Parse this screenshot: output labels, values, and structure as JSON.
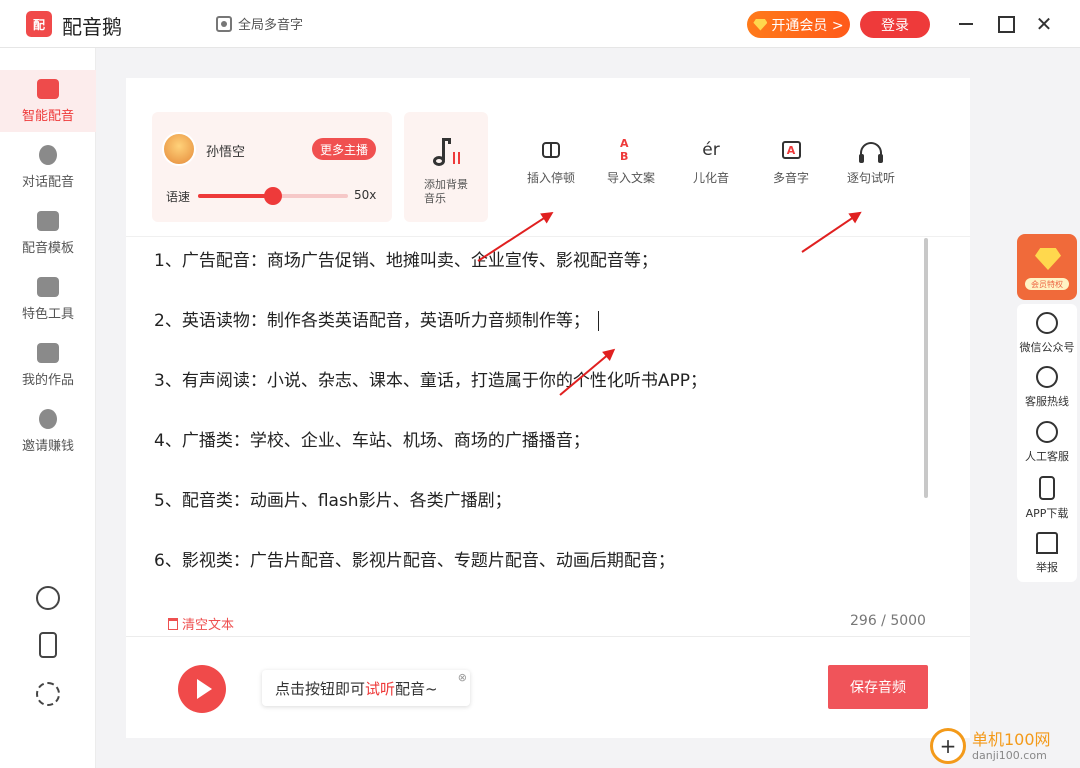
{
  "titlebar": {
    "logo_text": "配",
    "app_name": "配音鹅",
    "global_polyphone": "全局多音字",
    "vip_button": "开通会员 >",
    "login_button": "登录",
    "close_glyph": "✕"
  },
  "sidebar": {
    "items": [
      {
        "label": "智能配音",
        "icon": "smart-dub-icon",
        "active": true
      },
      {
        "label": "对话配音",
        "icon": "dialog-icon"
      },
      {
        "label": "配音模板",
        "icon": "template-icon"
      },
      {
        "label": "特色工具",
        "icon": "toolbox-icon"
      },
      {
        "label": "我的作品",
        "icon": "folder-icon"
      },
      {
        "label": "邀请赚钱",
        "icon": "money-bag-icon"
      }
    ],
    "bottom_icons": [
      "music-note-icon",
      "phone-icon",
      "gear-icon"
    ]
  },
  "anchor": {
    "name": "孙悟空",
    "more_button": "更多主播",
    "speed_label": "语速",
    "speed_value": "50x",
    "speed_fraction": 0.5
  },
  "bgm": {
    "label": "添加背景音乐"
  },
  "tools": [
    {
      "label": "插入停顿",
      "icon": "pause-insert-icon"
    },
    {
      "label": "导入文案",
      "icon": "import-text-icon",
      "glyph": "A B"
    },
    {
      "label": "儿化音",
      "icon": "er-sound-icon",
      "glyph": "ér"
    },
    {
      "label": "多音字",
      "icon": "polyphone-icon",
      "glyph": "A"
    },
    {
      "label": "逐句试听",
      "icon": "headphone-icon"
    }
  ],
  "text_lines": [
    "1、广告配音：商场广告促销、地摊叫卖、企业宣传、影视配音等；",
    "2、英语读物：制作各类英语配音，英语听力音频制作等；",
    "3、有声阅读：小说、杂志、课本、童话，打造属于你的个性化听书APP；",
    "4、广播类：学校、企业、车站、机场、商场的广播播音；",
    "5、配音类：动画片、flash影片、各类广播剧；",
    "6、影视类：广告片配音、影视片配音、专题片配音、动画后期配音；"
  ],
  "clear_text": "清空文本",
  "char_count": "296 / 5000",
  "tip": {
    "prefix": "点击按钮即可",
    "highlight": "试听",
    "suffix": "配音~",
    "close": "⊗"
  },
  "save_button": "保存音频",
  "right_panel": {
    "vip_tag": "会员特权",
    "items": [
      {
        "label": "微信公众号",
        "icon": "wechat-icon"
      },
      {
        "label": "客服热线",
        "icon": "phone-call-icon"
      },
      {
        "label": "人工客服",
        "icon": "service-icon"
      },
      {
        "label": "APP下载",
        "icon": "mobile-icon"
      },
      {
        "label": "举报",
        "icon": "alarm-icon"
      }
    ]
  },
  "watermark": {
    "text": "单机100网",
    "url": "danji100.com"
  },
  "colors": {
    "accent": "#ee3a3a",
    "vip": "#ff6a1a"
  }
}
